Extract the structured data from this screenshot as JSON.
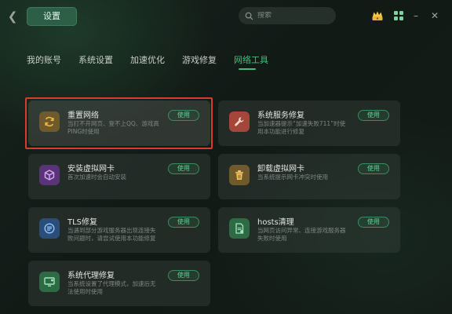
{
  "window": {
    "title": "设置",
    "back_icon": "back-arrow-icon",
    "search_placeholder": "搜索",
    "minimize_glyph": "–",
    "close_glyph": "✕"
  },
  "tabs": [
    {
      "label": "我的账号",
      "active": false
    },
    {
      "label": "系统设置",
      "active": false
    },
    {
      "label": "加速优化",
      "active": false
    },
    {
      "label": "游戏修复",
      "active": false
    },
    {
      "label": "网络工具",
      "active": true
    }
  ],
  "colors": {
    "accent": "#3fbf7f",
    "highlight_frame": "#d93a32"
  },
  "cards": [
    {
      "title": "重置网络",
      "desc": "当打不开网页、登不上QQ、游戏高PING时使用",
      "button": "使用",
      "icon": "refresh-network-icon",
      "icon_bg": "#6e5a2a",
      "highlighted": true
    },
    {
      "title": "系统服务修复",
      "desc": "当加速器提示“加速失败711”时使用本功能进行修复",
      "button": "使用",
      "icon": "wrench-icon",
      "icon_bg": "#a4473a",
      "highlighted": false
    },
    {
      "title": "安装虚拟网卡",
      "desc": "首次加速时会自动安装",
      "button": "使用",
      "icon": "cube-icon",
      "icon_bg": "#5a3478",
      "highlighted": false
    },
    {
      "title": "卸载虚拟网卡",
      "desc": "当系统提示网卡冲突时使用",
      "button": "使用",
      "icon": "trash-icon",
      "icon_bg": "#6e5a2a",
      "highlighted": false
    },
    {
      "title": "TLS修复",
      "desc": "当遇到部分游戏服务器出现连接失败问题时，请尝试使用本功能修复",
      "button": "使用",
      "icon": "tls-icon",
      "icon_bg": "#2a4e78",
      "highlighted": false
    },
    {
      "title": "hosts清理",
      "desc": "当网页访问异常、连接游戏服务器失败时使用",
      "button": "使用",
      "icon": "hosts-file-icon",
      "icon_bg": "#2e6a44",
      "highlighted": false
    },
    {
      "title": "系统代理修复",
      "desc": "当系统设置了代理模式，加速后无法使用时使用",
      "button": "使用",
      "icon": "monitor-icon",
      "icon_bg": "#2e6a44",
      "highlighted": false
    }
  ]
}
